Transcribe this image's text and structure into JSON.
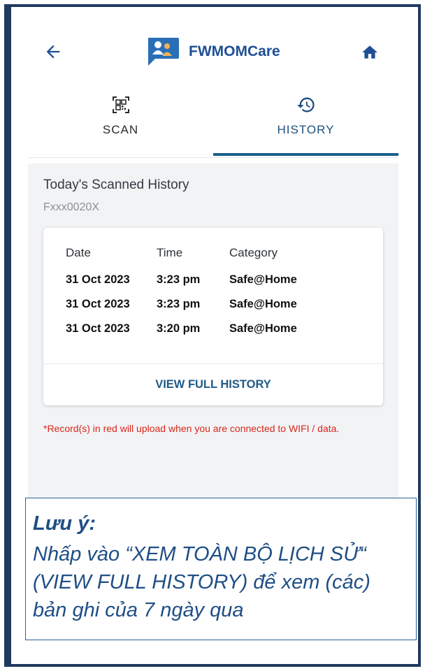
{
  "header": {
    "app_name": "FWMOMCare"
  },
  "tabs": [
    {
      "label": "SCAN",
      "icon": "qr-code-icon"
    },
    {
      "label": "HISTORY",
      "icon": "history-icon",
      "active": true
    }
  ],
  "history": {
    "title": "Today's Scanned History",
    "account_id": "Fxxx0020X",
    "columns": [
      "Date",
      "Time",
      "Category"
    ],
    "rows": [
      [
        "31 Oct 2023",
        "3:23 pm",
        "Safe@Home"
      ],
      [
        "31 Oct 2023",
        "3:23 pm",
        "Safe@Home"
      ],
      [
        "31 Oct 2023",
        "3:20 pm",
        "Safe@Home"
      ]
    ],
    "view_full_label": "VIEW FULL HISTORY",
    "offline_note": "*Record(s) in red will upload when you are connected to WIFI / data."
  },
  "note": {
    "title": "Lưu ý:",
    "body": "Nhấp vào “XEM TOÀN BỘ LỊCH SỬ“ (VIEW FULL HISTORY) để xem (các) bản ghi của 7 ngày qua"
  },
  "colors": {
    "brand_blue": "#1e4f94",
    "tab_underline": "#1b5f8c",
    "warning_red": "#d9261c",
    "note_blue": "#1f4e85"
  }
}
